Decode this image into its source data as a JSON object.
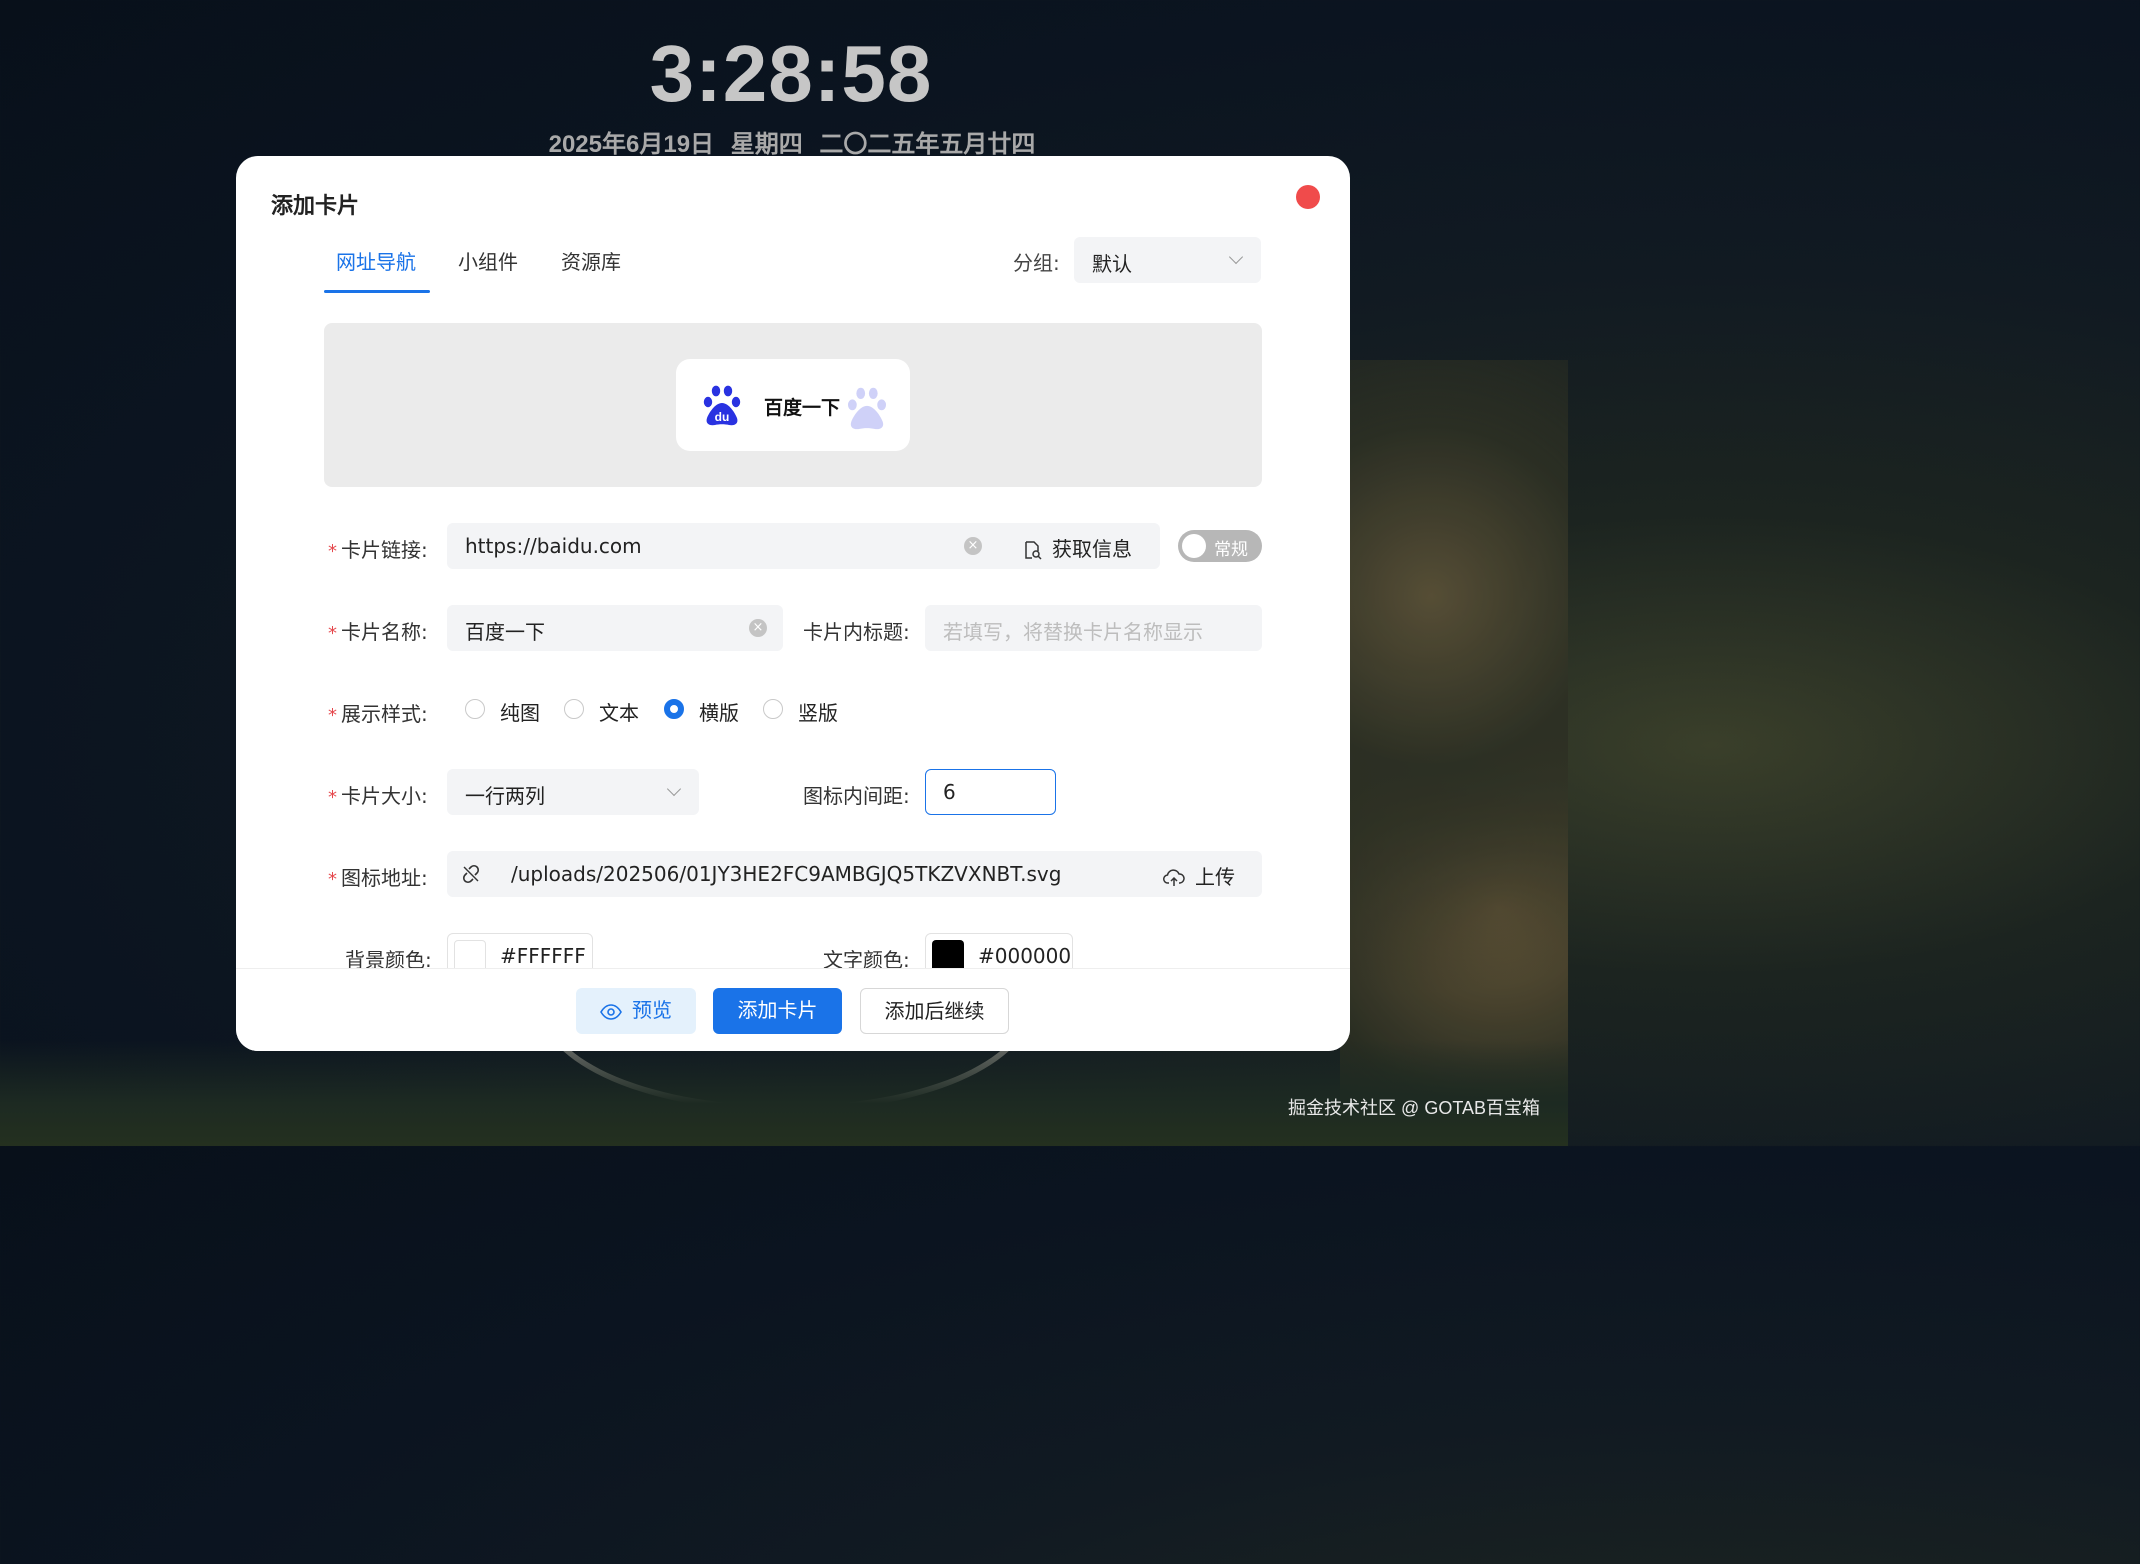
{
  "clock": {
    "time": "3:28:58",
    "date": "2025年6月19日 星期四 二〇二五年五月廿四"
  },
  "dialog": {
    "title": "添加卡片",
    "tabs": [
      {
        "label": "网址导航",
        "active": true
      },
      {
        "label": "小组件"
      },
      {
        "label": "资源库"
      }
    ],
    "group": {
      "label": "分组:",
      "value": "默认"
    },
    "preview_card": {
      "name": "百度一下",
      "logo_icon": "baidu-paw-icon"
    },
    "form": {
      "card_link": {
        "label": "卡片链接:",
        "value": "https://baidu.com",
        "fetch_label": "获取信息"
      },
      "toggle": {
        "label": "常规",
        "on": false
      },
      "card_name": {
        "label": "卡片名称:",
        "value": "百度一下"
      },
      "card_subtitle": {
        "label": "卡片内标题:",
        "placeholder": "若填写，将替换卡片名称显示"
      },
      "display_style": {
        "label": "展示样式:",
        "options": [
          "纯图",
          "文本",
          "横版",
          "竖版"
        ],
        "selected": "横版"
      },
      "card_size": {
        "label": "卡片大小:",
        "value": "一行两列"
      },
      "icon_padding": {
        "label": "图标内间距:",
        "value": "6"
      },
      "icon_url": {
        "label": "图标地址:",
        "value": "/uploads/202506/01JY3HE2FC9AMBGJQ5TKZVXNBT.svg",
        "upload_label": "上传"
      },
      "bg_color": {
        "label": "背景颜色:",
        "value": "#FFFFFF"
      },
      "text_color": {
        "label": "文字颜色:",
        "value": "#000000"
      }
    },
    "footer": {
      "preview": "预览",
      "add": "添加卡片",
      "add_continue": "添加后继续"
    }
  },
  "watermark": "掘金技术社区 @ GOTAB百宝箱",
  "colors": {
    "accent": "#1a73e8",
    "close": "#f04b4b",
    "baidu_blue": "#2932e1"
  }
}
